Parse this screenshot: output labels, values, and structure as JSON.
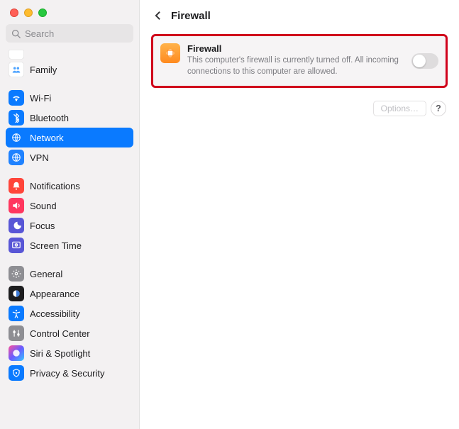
{
  "sidebar": {
    "search_placeholder": "Search",
    "items": [
      {
        "label": "",
        "icon": "peek-icon",
        "bg": "bg-white",
        "peek": true
      },
      {
        "label": "Family",
        "icon": "family-icon",
        "bg": "bg-white"
      },
      {
        "gap": true
      },
      {
        "label": "Wi-Fi",
        "icon": "wifi-icon",
        "bg": "bg-blue"
      },
      {
        "label": "Bluetooth",
        "icon": "bluetooth-icon",
        "bg": "bg-blue"
      },
      {
        "label": "Network",
        "icon": "network-icon",
        "bg": "bg-blue",
        "selected": true
      },
      {
        "label": "VPN",
        "icon": "vpn-icon",
        "bg": "bg-blue2"
      },
      {
        "gap": true
      },
      {
        "label": "Notifications",
        "icon": "notifications-icon",
        "bg": "bg-red"
      },
      {
        "label": "Sound",
        "icon": "sound-icon",
        "bg": "bg-pink"
      },
      {
        "label": "Focus",
        "icon": "focus-icon",
        "bg": "bg-indigo"
      },
      {
        "label": "Screen Time",
        "icon": "screen-time-icon",
        "bg": "bg-indigo"
      },
      {
        "gap": true
      },
      {
        "label": "General",
        "icon": "general-icon",
        "bg": "bg-gray"
      },
      {
        "label": "Appearance",
        "icon": "appearance-icon",
        "bg": "bg-dark"
      },
      {
        "label": "Accessibility",
        "icon": "accessibility-icon",
        "bg": "bg-blue"
      },
      {
        "label": "Control Center",
        "icon": "control-center-icon",
        "bg": "bg-gray"
      },
      {
        "label": "Siri & Spotlight",
        "icon": "siri-icon",
        "bg": "bg-grad"
      },
      {
        "label": "Privacy & Security",
        "icon": "privacy-icon",
        "bg": "bg-blue"
      }
    ]
  },
  "header": {
    "title": "Firewall"
  },
  "firewall_card": {
    "title": "Firewall",
    "description": "This computer's firewall is currently turned off. All incoming connections to this computer are allowed.",
    "enabled": false
  },
  "footer": {
    "options_label": "Options…",
    "help_label": "?"
  }
}
